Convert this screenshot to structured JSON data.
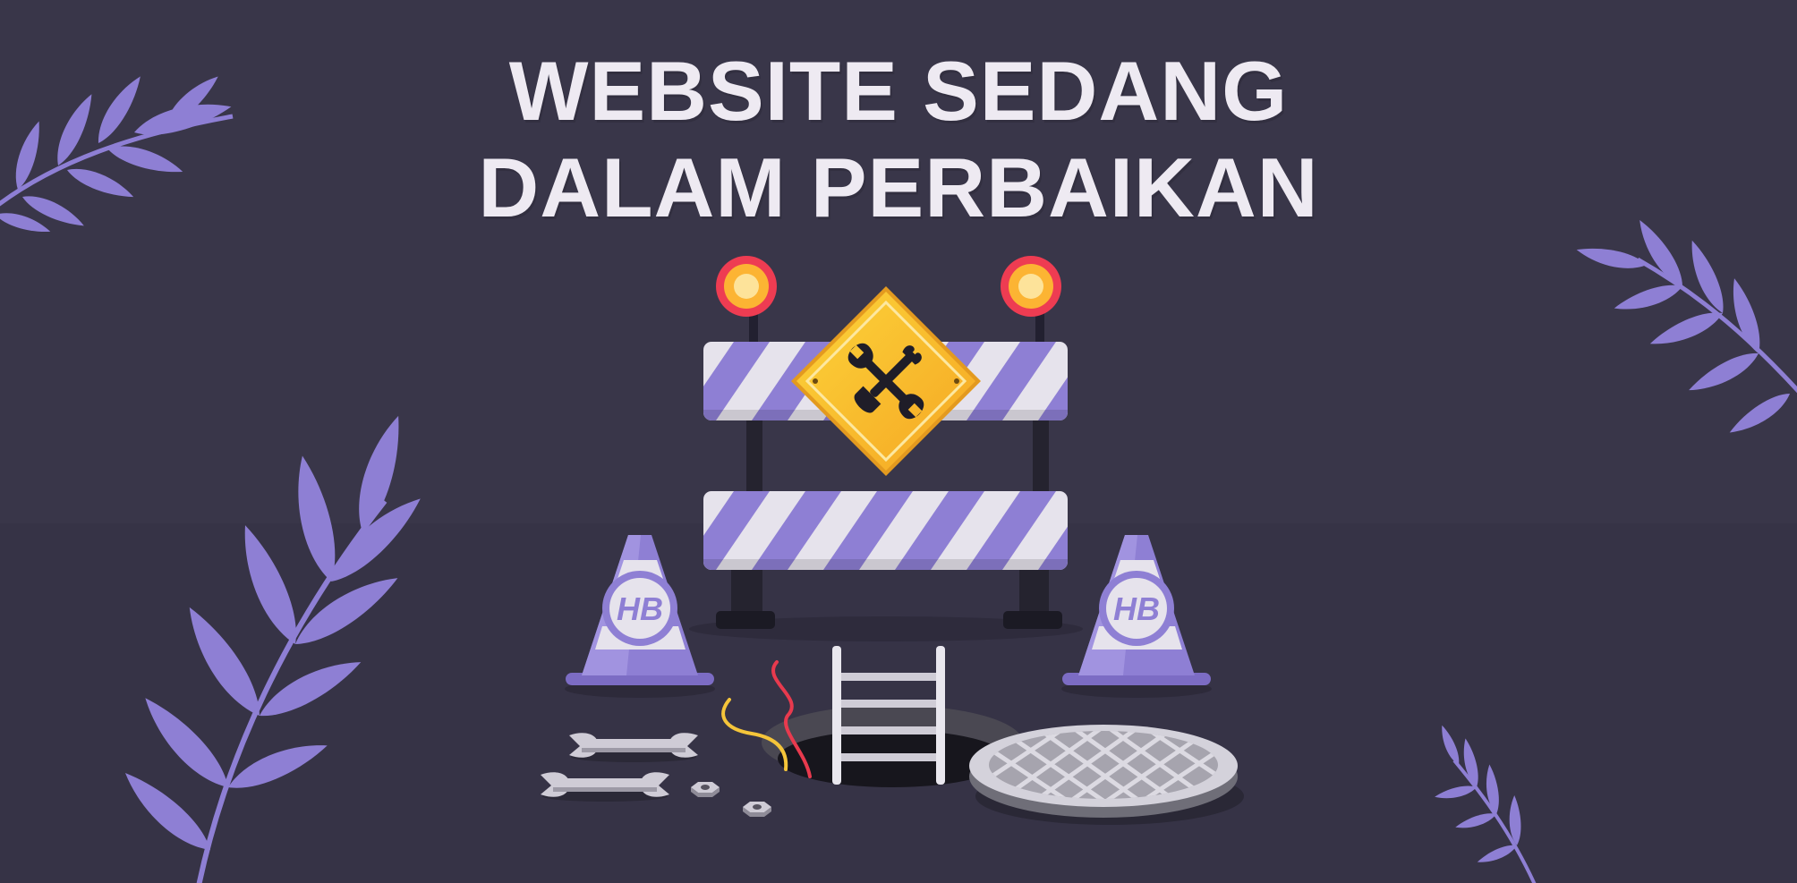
{
  "heading": {
    "line1": "WEBSITE SEDANG",
    "line2": "DALAM PERBAIKAN"
  },
  "cone_logo": "HB",
  "colors": {
    "background": "#393649",
    "accent_purple": "#8e7fd4",
    "sign_yellow": "#f7b92c",
    "light_red": "#ee3c52",
    "title_text": "#eeeaf2"
  },
  "icons": [
    "leaf-branch-icon",
    "warning-light-icon",
    "wrench-screwdriver-icon",
    "traffic-cone-icon",
    "wrench-icon",
    "nut-icon",
    "ladder-icon",
    "manhole-cover-icon"
  ]
}
